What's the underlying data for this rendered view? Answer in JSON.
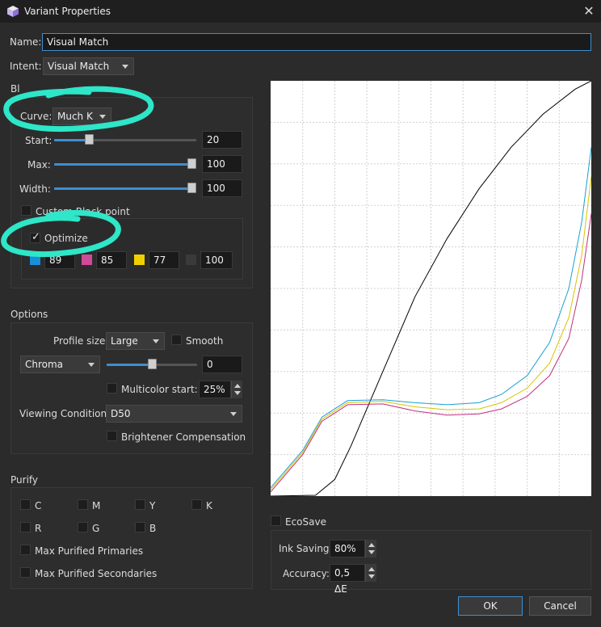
{
  "window": {
    "title": "Variant Properties",
    "app_icon": "cube-icon",
    "close_icon": "close-icon"
  },
  "name": {
    "label": "Name:",
    "value": "Visual Match"
  },
  "intent": {
    "label": "Intent:",
    "value": "Visual Match"
  },
  "black": {
    "section_label": "Bl",
    "curve": {
      "label": "Curve:",
      "value": "Much K"
    },
    "start": {
      "label": "Start:",
      "value": "20",
      "fraction": 0.2
    },
    "max": {
      "label": "Max:",
      "value": "100",
      "fraction": 1.0
    },
    "width": {
      "label": "Width:",
      "value": "100",
      "fraction": 1.0
    },
    "custom_black_point": {
      "label": "Custom Black point",
      "checked": false
    },
    "optimize": {
      "label": "Optimize",
      "checked": true
    },
    "cmyk": [
      {
        "color": "#1a8fd8",
        "value": "89"
      },
      {
        "color": "#d04a9a",
        "value": "85"
      },
      {
        "color": "#f1d000",
        "value": "77"
      },
      {
        "color": "#3a3a3a",
        "value": "100"
      }
    ]
  },
  "options": {
    "section_label": "Options",
    "profile_size": {
      "label": "Profile size:",
      "value": "Large"
    },
    "smooth": {
      "label": "Smooth",
      "checked": false
    },
    "chroma": {
      "value": "Chroma",
      "amount": "0",
      "fraction": 0.5
    },
    "multicolor_start": {
      "label": "Multicolor start:",
      "value": "25%",
      "checked": false
    },
    "viewing_condition": {
      "label": "Viewing Condition:",
      "value": "D50"
    },
    "brightener": {
      "label": "Brightener Compensation",
      "checked": false
    }
  },
  "purify": {
    "section_label": "Purify",
    "row1": [
      "C",
      "M",
      "Y",
      "K"
    ],
    "row2": [
      "R",
      "G",
      "B"
    ],
    "max_primaries": "Max Purified Primaries",
    "max_secondaries": "Max Purified Secondaries"
  },
  "ecosave": {
    "label": "EcoSave",
    "checked": false,
    "ink_saving": {
      "label": "Ink Saving:",
      "value": "80%"
    },
    "accuracy": {
      "label": "Accuracy:",
      "value": "0,5 ΔE"
    }
  },
  "buttons": {
    "ok": "OK",
    "cancel": "Cancel"
  },
  "colors": {
    "accent": "#3e8ed0",
    "annotation": "#2ee6c8"
  },
  "chart_data": {
    "type": "line",
    "xlim": [
      0,
      100
    ],
    "ylim": [
      0,
      100
    ],
    "grid": true,
    "series": [
      {
        "color": "#000000",
        "x": [
          0,
          14,
          20,
          25,
          35,
          45,
          55,
          65,
          75,
          85,
          95,
          100
        ],
        "y": [
          0,
          0.2,
          4,
          12,
          30,
          48,
          62,
          74,
          84,
          92,
          98,
          100
        ]
      },
      {
        "color": "#1a9fd0",
        "x": [
          0,
          10,
          16,
          24,
          35,
          45,
          55,
          65,
          72,
          80,
          87,
          93,
          97,
          100
        ],
        "y": [
          2,
          11,
          19,
          23,
          23.2,
          22.5,
          22,
          22.5,
          24.5,
          29,
          37,
          50,
          66,
          84
        ]
      },
      {
        "color": "#d8c400",
        "x": [
          0,
          10,
          16,
          24,
          35,
          45,
          55,
          65,
          72,
          80,
          87,
          93,
          97,
          100
        ],
        "y": [
          1.5,
          10.5,
          18.5,
          22.5,
          22.8,
          21.5,
          20.8,
          21,
          22.5,
          26,
          32,
          43,
          58,
          77
        ]
      },
      {
        "color": "#c0307e",
        "x": [
          0,
          10,
          16,
          24,
          35,
          45,
          55,
          65,
          72,
          80,
          87,
          93,
          97,
          100
        ],
        "y": [
          1,
          10,
          18,
          22,
          22.2,
          20.5,
          19.5,
          19.8,
          21,
          24,
          29,
          38,
          52,
          68
        ]
      }
    ]
  }
}
